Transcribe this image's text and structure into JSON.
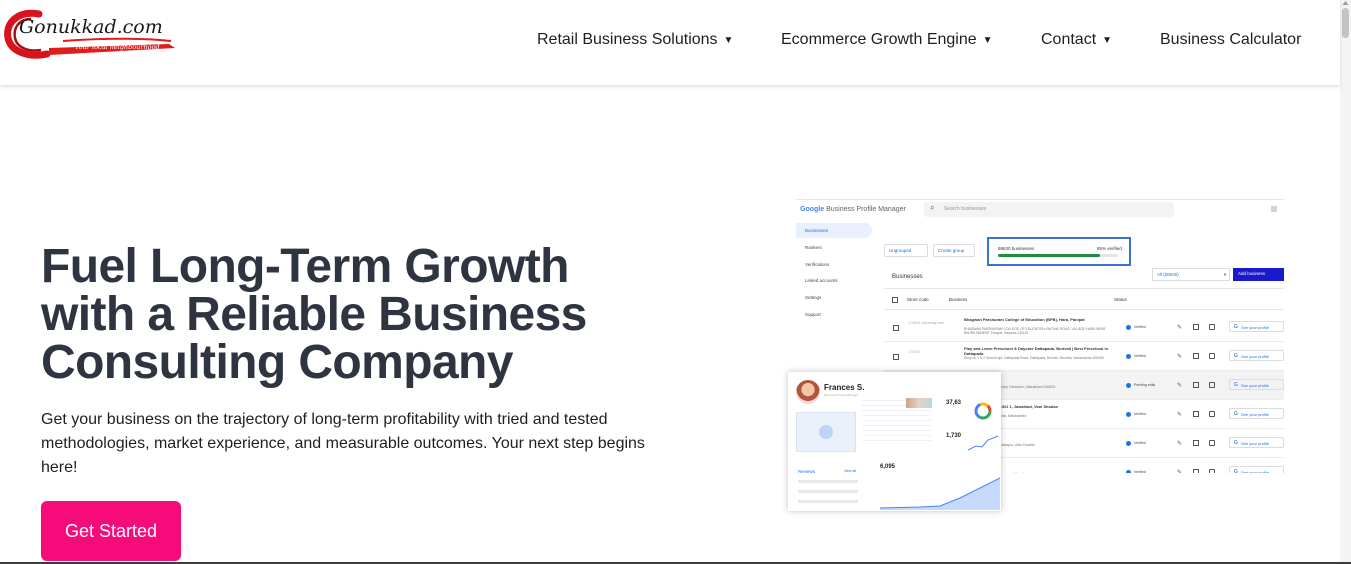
{
  "header": {
    "logo": {
      "brand": "Gonukkad.com",
      "tagline": "Your local neighbourhood"
    },
    "nav": [
      {
        "label": "Retail Business Solutions",
        "caret": "▼"
      },
      {
        "label": "Ecommerce Growth Engine",
        "caret": "▼"
      },
      {
        "label": "Contact",
        "caret": "▼"
      },
      {
        "label": "Business Calculator"
      }
    ]
  },
  "hero": {
    "title_lines": [
      "Fuel Long-Term Growth",
      "with a Reliable Business",
      "Consulting Company"
    ],
    "description": "Get your business on the trajectory of long-term profitability with tried and tested methodologies, market experience, and measurable outcomes. Your next step begins here!",
    "cta_label": "Get Started"
  },
  "screenshot": {
    "app_google": "Google",
    "app_name": "Business Profile Manager",
    "search_placeholder": "Search businesses",
    "grid_icon": "apps-grid-icon",
    "sidebar": [
      "Businesses",
      "Rankers",
      "Verifications",
      "Linked accounts",
      "Settings",
      "Support"
    ],
    "group_select": "Ungrouped",
    "create_group": "Create group",
    "count_label": "58630 businesses",
    "verified_label": "85% verified",
    "verified_pct": 85,
    "section_title": "Businesses",
    "filter_label": "All (58630)",
    "add_business": "Add business",
    "col_store": "Store code",
    "col_business": "Business",
    "col_status": "Status",
    "rows": [
      {
        "store": "17461E University cafe",
        "name": "Bhagwan Parshuram College of Education (BPB), Hara, Panipat",
        "address": "BHAGWAN PARSHURAM COLLEGE OF EDUCATION KAITHAL ROAD, VILLAGE HARA NEAR BAHRA PANIPAT, Panipat, Haryana 132119",
        "status": "Verified"
      },
      {
        "store": "174570",
        "name": "Play and Learn Preschool & Daycare Dattapada, Borivali | Best Preschool in Dattapada",
        "address": "Shop no 1 & 2 Ground opt, Dattapada Road, Dattapada, Borivali, Mumbai, Maharashtra 400066",
        "status": "Verified"
      },
      {
        "store": "",
        "name": "ENCS",
        "address": "Near Shiv mandir colony road, Dehradun, Uttarakhand 248001",
        "status": "Pending edits"
      },
      {
        "store": "",
        "name": "Complex, Gali No. 1/6/1 1, Jawahlad, Vani Shodan",
        "address": "Indor, District Nashik, Nashik, Maharashtra",
        "status": "Verified"
      },
      {
        "store": "",
        "name": "ozie — Ram Tyres",
        "address": "Kirari Road, Prataapur, Prataapur, Uttar Pradesh",
        "status": "Verified"
      },
      {
        "store": "",
        "name": "Nutrition",
        "address": "Near Jyoti Road, Jawahar colony, Meerut",
        "status": "Verified"
      }
    ],
    "see_profile": "See your profile",
    "g_mark": "G",
    "profile": {
      "name": "Frances S.",
      "subtitle": "Business Profile Manager",
      "reviews_title": "Reviews",
      "view_all": "View all",
      "stat1": "37,63",
      "stat2": "1,730",
      "stat3": "6,095"
    }
  },
  "colors": {
    "accent": "#f50c7a",
    "heading": "#2f3441",
    "google_blue": "#1a73e8",
    "google_red": "#ea4335",
    "google_yellow": "#fbbc04",
    "google_green": "#34a853",
    "add_business_bg": "#1a1acd",
    "progress": "#1e8e3e"
  }
}
